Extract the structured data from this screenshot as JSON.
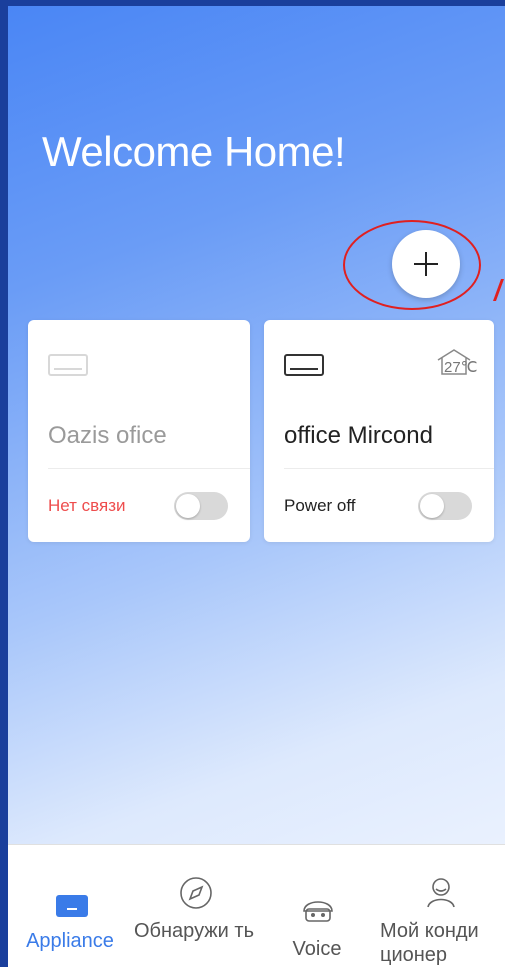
{
  "header": {
    "title": "Welcome Home!"
  },
  "add_button": {
    "symbol": "+"
  },
  "devices": [
    {
      "name": "Oazis ofice",
      "status": "Нет связи",
      "online": false,
      "power_on": false
    },
    {
      "name": "office Mircond",
      "status": "Power off",
      "temperature": "27℃",
      "online": true,
      "power_on": false
    }
  ],
  "tabs": [
    {
      "label": "Appliance",
      "icon": "appliance-icon",
      "active": true
    },
    {
      "label": "Обнаружи ть",
      "icon": "compass-icon",
      "active": false
    },
    {
      "label": "Voice",
      "icon": "voice-robot-icon",
      "active": false
    },
    {
      "label": "Мой конди ционер",
      "icon": "user-profile-icon",
      "active": false
    }
  ],
  "colors": {
    "accent": "#3a7be8",
    "offline": "#ee4d4d",
    "annotation": "#e02020"
  }
}
